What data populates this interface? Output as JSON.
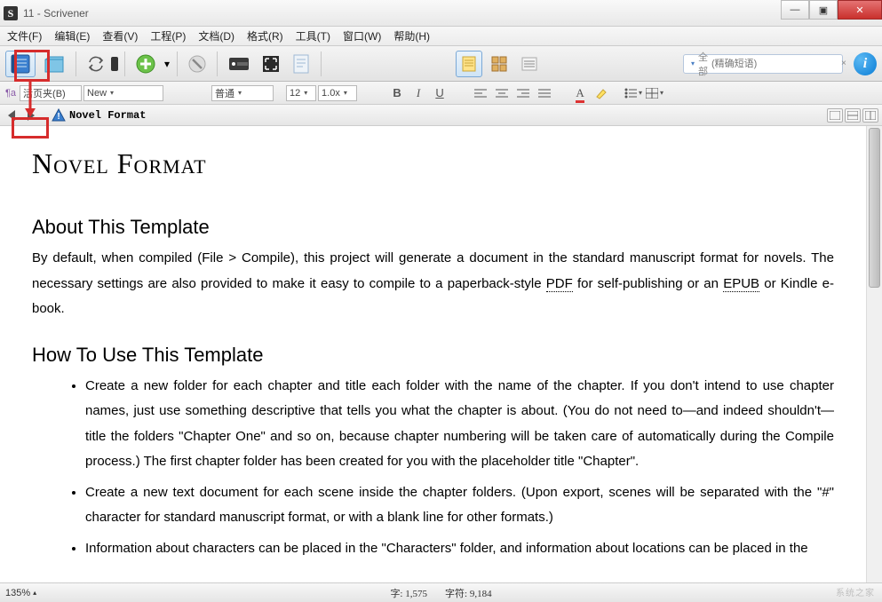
{
  "title": "11 - Scrivener",
  "app_icon_letter": "S",
  "window_controls": {
    "minimize": "—",
    "maximize": "▣",
    "close": "✕"
  },
  "menu": [
    "文件(F)",
    "编辑(E)",
    "查看(V)",
    "工程(P)",
    "文档(D)",
    "格式(R)",
    "工具(T)",
    "窗口(W)",
    "帮助(H)"
  ],
  "toolbar": {
    "binder_icon": "binder",
    "folder_icon": "folder",
    "sync_icon": "sync",
    "add_icon": "add",
    "trash_icon": "trash",
    "keywords_icon": "keywords",
    "fullscreen_icon": "fullscreen",
    "compose_icon": "compose",
    "view_single_icon": "view-single",
    "view_cork_icon": "view-corkboard",
    "view_outline_icon": "view-outline"
  },
  "search": {
    "scope": "全部",
    "placeholder": "(精确短语)",
    "clear": "×"
  },
  "info_label": "i",
  "format": {
    "section_label": "活页夹(B)",
    "font_name": "New",
    "style": "普通",
    "font_size": "12",
    "line_spacing": "1.0x",
    "bold": "B",
    "italic": "I",
    "underline": "U"
  },
  "path": {
    "doc_title": "Novel Format",
    "info_icon": "ℹ"
  },
  "doc": {
    "h1": "Novel Format",
    "h2a": "About This Template",
    "p1a": "By default, when compiled (File > Compile), this project will generate a document in the standard manuscript format for novels. The necessary settings are also provided to make it easy to compile to a paperback-style ",
    "p1_pdf": "PDF",
    "p1b": " for self-publishing or an ",
    "p1_epub": "EPUB",
    "p1c": " or Kindle e-book.",
    "h2b": "How To Use This Template",
    "li1": "Create a new folder for each chapter and title each folder with the name of the chapter. If you don't intend to use chapter names, just use something descriptive that tells you what the chapter is about. (You do not need to—and indeed shouldn't—title the folders \"Chapter One\" and so on, because chapter numbering will be taken care of automatically during the Compile process.) The first chapter folder has been created for you with the placeholder title \"Chapter\".",
    "li2": "Create a new text document for each scene inside the chapter folders. (Upon export, scenes will be separated with the \"#\" character for standard manuscript format, or with a blank line for other formats.)",
    "li3": "Information about characters can be placed in the \"Characters\" folder, and information about locations can be placed in the"
  },
  "status": {
    "zoom": "135%",
    "words_label": "字:",
    "words": "1,575",
    "chars_label": "字符:",
    "chars": "9,184"
  },
  "watermark": "系统之家"
}
